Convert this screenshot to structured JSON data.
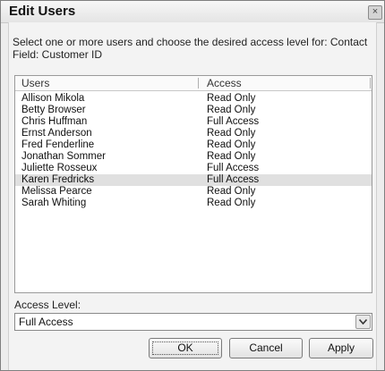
{
  "window": {
    "title": "Edit Users",
    "close_glyph": "×"
  },
  "instructions": "Select one or more users and choose the desired access level for: Contact Field: Customer ID",
  "list": {
    "columns": [
      "Users",
      "Access"
    ],
    "rows": [
      {
        "user": "Allison Mikola",
        "access": "Read Only"
      },
      {
        "user": "Betty Browser",
        "access": "Read Only"
      },
      {
        "user": "Chris Huffman",
        "access": "Full Access"
      },
      {
        "user": "Ernst Anderson",
        "access": "Read Only"
      },
      {
        "user": "Fred Fenderline",
        "access": "Read Only"
      },
      {
        "user": "Jonathan Sommer",
        "access": "Read Only"
      },
      {
        "user": "Juliette Rosseux",
        "access": "Full Access"
      },
      {
        "user": "Karen Fredricks",
        "access": "Full Access"
      },
      {
        "user": "Melissa Pearce",
        "access": "Read Only"
      },
      {
        "user": "Sarah Whiting",
        "access": "Read Only"
      }
    ],
    "selected_user": "Karen Fredricks"
  },
  "access_level": {
    "label": "Access Level:",
    "value": "Full Access"
  },
  "buttons": {
    "ok": "OK",
    "cancel": "Cancel",
    "apply": "Apply"
  },
  "icons": {
    "close": "close-icon",
    "dropdown": "chevron-down-icon"
  }
}
